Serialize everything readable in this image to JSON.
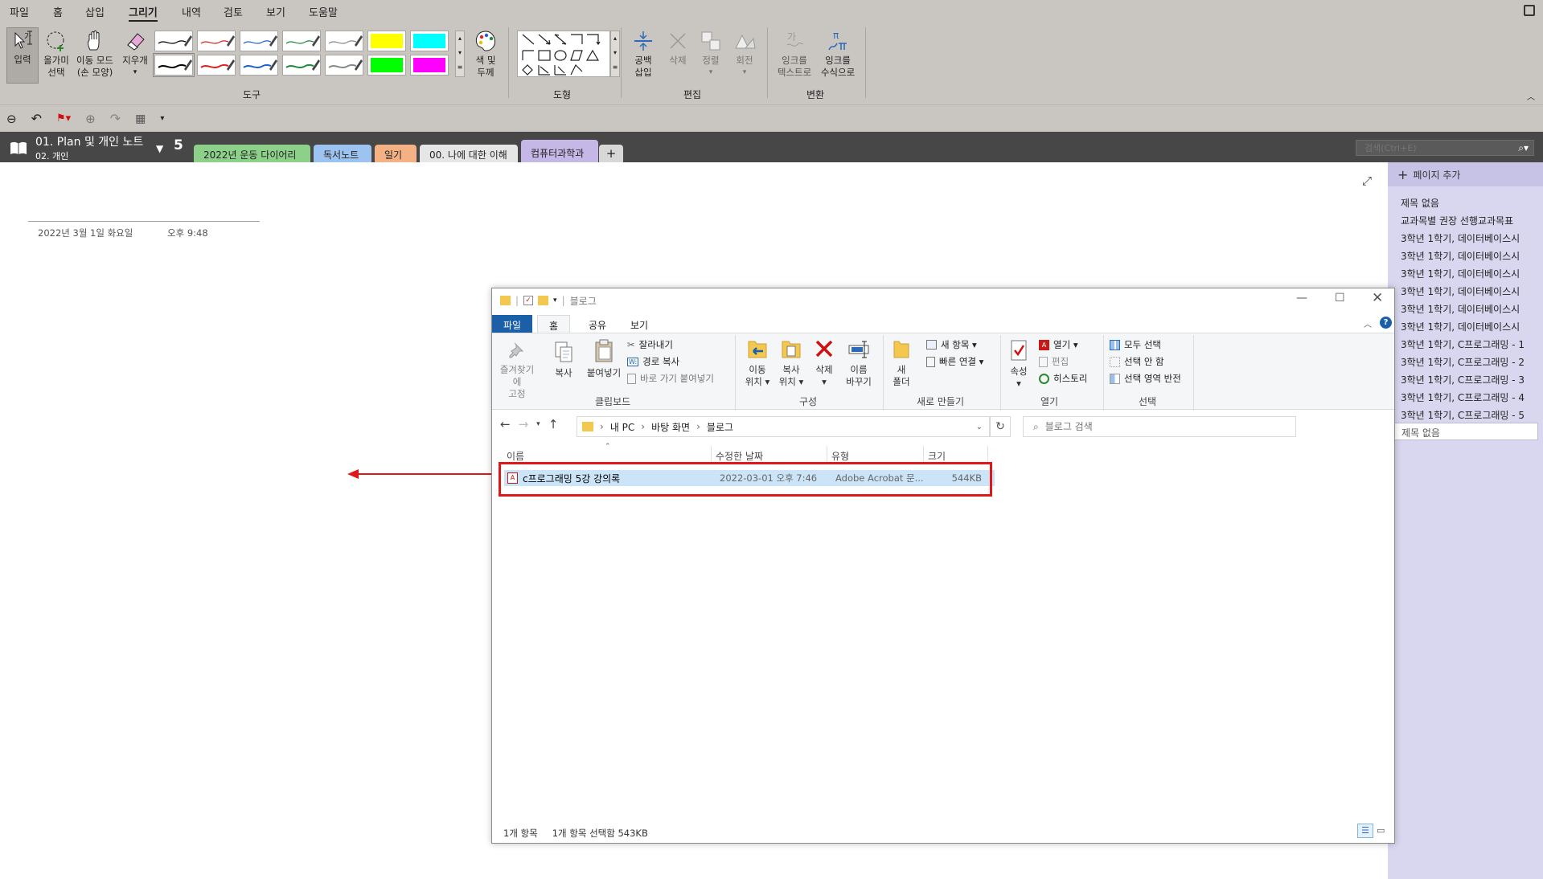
{
  "menu": [
    "파일",
    "홈",
    "삽입",
    "그리기",
    "내역",
    "검토",
    "보기",
    "도움말"
  ],
  "menu_active": "그리기",
  "ribbon": {
    "input_label": "입력",
    "lasso_label": "올가미\n선택",
    "pan_label": "이동 모드\n(손 모양)",
    "eraser_label": "지우개",
    "color_label": "색 및\n두께",
    "tools_group": "도구",
    "shapes_group": "도형",
    "space_label": "공백\n삽입",
    "delete_label": "삭제",
    "arrange_label": "정렬",
    "rotate_label": "회전",
    "edit_group": "편집",
    "ink_text_label": "잉크를\n텍스트로",
    "ink_math_label": "잉크를\n수식으로",
    "convert_group": "변환",
    "pen_colors": [
      "#000000",
      "#e02020",
      "#2060d0",
      "#1f8a3b",
      "#888888",
      "#ffff00",
      "#00ffff",
      "#000000",
      "#e02020",
      "#2060d0",
      "#1f8a3b",
      "#888888",
      "#00ff00",
      "#ff00ff"
    ]
  },
  "notebook": {
    "title": "01. Plan 및 개인 노트",
    "section_group": "02. 개인",
    "count": "5",
    "tabs": [
      {
        "label": "2022년 운동 다이어리",
        "color": "#8dd08a"
      },
      {
        "label": "독서노트",
        "color": "#9dc3f0"
      },
      {
        "label": "일기",
        "color": "#f4b183"
      },
      {
        "label": "00. 나에 대한 이해",
        "color": "#e6e6e6"
      },
      {
        "label": "컴퓨터과학과",
        "color": "#c6b8e6"
      }
    ],
    "add_tab": "+",
    "search_placeholder": "검색(Ctrl+E)"
  },
  "page": {
    "date": "2022년 3월 1일 화요일",
    "time": "오후 9:48"
  },
  "page_list": {
    "add_page": "페이지 추가",
    "items": [
      "제목 없음",
      "교과목별 권장 선행교과목표",
      "3학년 1학기, 데이터베이스시",
      "3학년 1학기, 데이터베이스시",
      "3학년 1학기, 데이터베이스시",
      "3학년 1학기, 데이터베이스시",
      "3학년 1학기, 데이터베이스시",
      "3학년 1학기, 데이터베이스시",
      "3학년 1학기, C프로그래밍 - 1",
      "3학년 1학기, C프로그래밍 - 2",
      "3학년 1학기, C프로그래밍 - 3",
      "3학년 1학기, C프로그래밍 - 4",
      "3학년 1학기, C프로그래밍 - 5"
    ],
    "selected": "제목 없음"
  },
  "explorer": {
    "title": "블로그",
    "tabs": [
      "파일",
      "홈",
      "공유",
      "보기"
    ],
    "active_tab": "홈",
    "clipboard": {
      "pin": "즐겨찾기에\n고정",
      "copy": "복사",
      "paste": "붙여넣기",
      "cut": "잘라내기",
      "copy_path": "경로 복사",
      "paste_shortcut": "바로 가기 붙여넣기",
      "group": "클립보드"
    },
    "organize": {
      "move": "이동\n위치 ▾",
      "copy_to": "복사\n위치 ▾",
      "delete": "삭제\n▾",
      "rename": "이름\n바꾸기",
      "group": "구성"
    },
    "new": {
      "folder": "새\n폴더",
      "new_item": "새 항목 ▾",
      "easy_access": "빠른 연결 ▾",
      "group": "새로 만들기"
    },
    "open": {
      "properties": "속성\n▾",
      "open": "열기 ▾",
      "edit": "편집",
      "history": "히스토리",
      "group": "열기"
    },
    "select": {
      "all": "모두 선택",
      "none": "선택 안 함",
      "invert": "선택 영역 반전",
      "group": "선택"
    },
    "breadcrumb": [
      "내 PC",
      "바탕 화면",
      "블로그"
    ],
    "search_placeholder": "블로그 검색",
    "columns": [
      "이름",
      "수정한 날짜",
      "유형",
      "크기"
    ],
    "files": [
      {
        "name": "c프로그래밍 5강 강의록",
        "date": "2022-03-01 오후 7:46",
        "type": "Adobe Acrobat 문...",
        "size": "544KB"
      }
    ],
    "status": {
      "count": "1개 항목",
      "selected": "1개 항목 선택함 543KB"
    }
  }
}
